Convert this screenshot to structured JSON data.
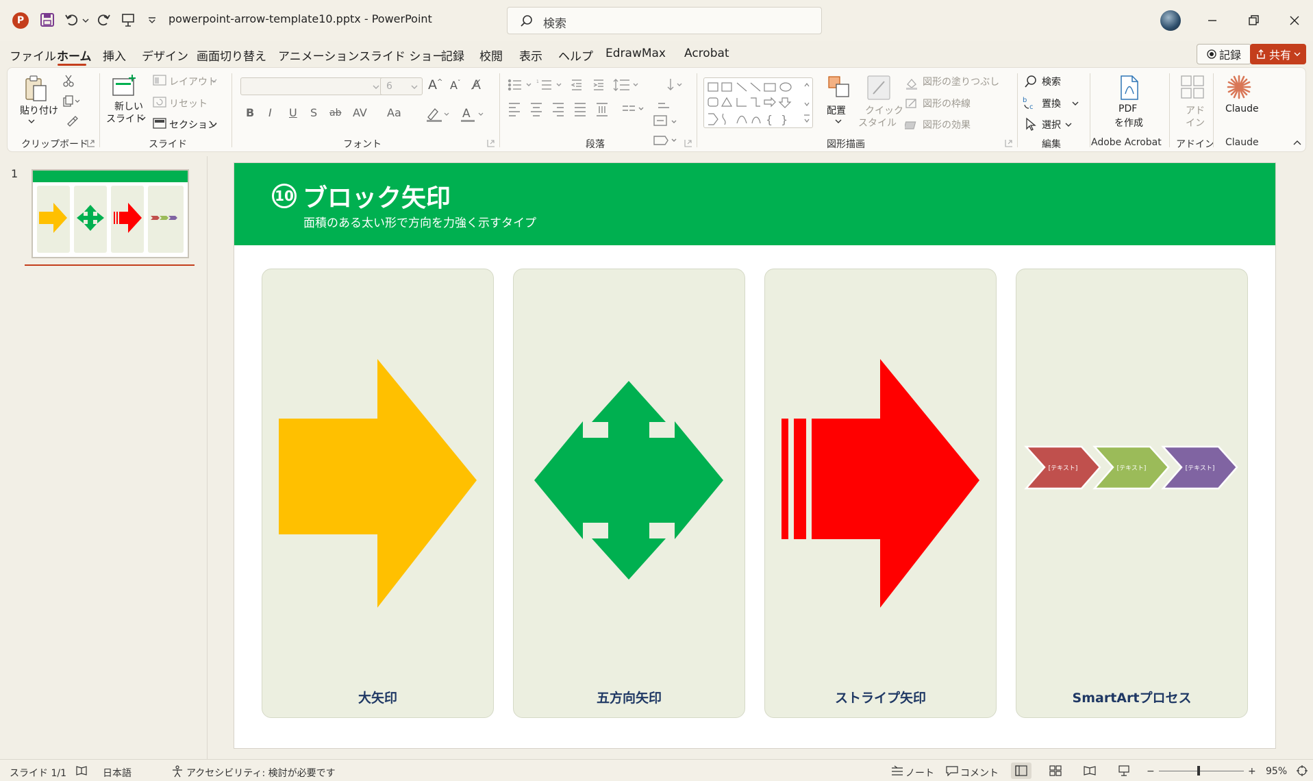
{
  "titlebar": {
    "filename": "powerpoint-arrow-template10.pptx",
    "separator": "-",
    "app_name": "PowerPoint",
    "search_placeholder": "検索"
  },
  "menu": {
    "tabs": [
      "ファイル",
      "ホーム",
      "挿入",
      "デザイン",
      "画面切り替え",
      "アニメーション",
      "スライド ショー",
      "記録",
      "校閲",
      "表示",
      "ヘルプ",
      "EdrawMax",
      "Acrobat"
    ],
    "active_tab": "ホーム",
    "record_label": "記録",
    "share_label": "共有"
  },
  "ribbon": {
    "clipboard": {
      "paste": "貼り付け",
      "group": "クリップボード"
    },
    "slides": {
      "new_slide_1": "新しい",
      "new_slide_2": "スライド",
      "layout": "レイアウト",
      "reset": "リセット",
      "section": "セクション",
      "group": "スライド"
    },
    "font": {
      "size": "6",
      "group": "フォント",
      "bold": "B",
      "italic": "I",
      "underline": "U",
      "shadow": "S",
      "strike": "ab",
      "case": "Aa"
    },
    "paragraph": {
      "group": "段落"
    },
    "drawing": {
      "arrange": "配置",
      "quick_style_1": "クイック",
      "quick_style_2": "スタイル",
      "fill": "図形の塗りつぶし",
      "outline": "図形の枠線",
      "effects": "図形の効果",
      "group": "図形描画"
    },
    "editing": {
      "find": "検索",
      "replace": "置換",
      "select": "選択",
      "group": "編集"
    },
    "acrobat": {
      "pdf_1": "PDF",
      "pdf_2": "を作成",
      "group": "Adobe Acrobat"
    },
    "addins": {
      "label_1": "アド",
      "label_2": "イン",
      "group": "アドイン"
    },
    "claude": {
      "label": "Claude",
      "group": "Claude"
    }
  },
  "slide_panel": {
    "slide_number": "1"
  },
  "slide": {
    "number_badge": "⑩",
    "title": "ブロック矢印",
    "subtitle": "面積のある太い形で方向を力強く示すタイプ",
    "cards": [
      {
        "label": "大矢印",
        "color": "#ffc000"
      },
      {
        "label": "五方向矢印",
        "color": "#00b050"
      },
      {
        "label": "ストライプ矢印",
        "color": "#ff0000"
      },
      {
        "label": "SmartArtプロセス",
        "chevrons": [
          {
            "text": "[テキスト]",
            "color": "#c0504d"
          },
          {
            "text": "[テキスト]",
            "color": "#9bbb59"
          },
          {
            "text": "[テキスト]",
            "color": "#8064a2"
          }
        ]
      }
    ]
  },
  "statusbar": {
    "slide_count": "スライド 1/1",
    "language": "日本語",
    "accessibility": "アクセシビリティ: 検討が必要です",
    "notes": "ノート",
    "comments": "コメント",
    "zoom_minus": "−",
    "zoom_plus": "+",
    "zoom": "95%"
  },
  "colors": {
    "accent": "#c43e1c",
    "header_green": "#00b050",
    "card_bg": "#ecefe0",
    "label_navy": "#1f3864"
  }
}
